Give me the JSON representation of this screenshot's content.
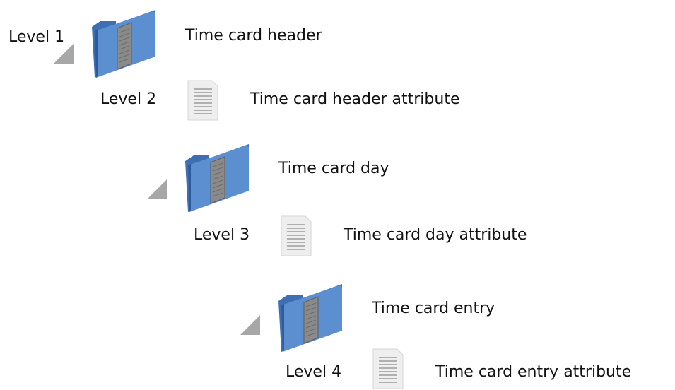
{
  "levels": {
    "level1": "Level 1",
    "level2": "Level 2",
    "level3": "Level 3",
    "level4": "Level 4"
  },
  "items": {
    "time_card_header": "Time card header",
    "time_card_header_attribute": "Time card header attribute",
    "time_card_day": "Time card day",
    "time_card_day_attribute": "Time card day attribute",
    "time_card_entry": "Time card entry",
    "time_card_entry_attribute": "Time card entry attribute"
  },
  "colors": {
    "folder_front": "#5b8fd0",
    "folder_back": "#3f6fb3",
    "folder_page": "#8a8a8a",
    "triangle": "#a7a7a7",
    "document_fill": "#eeeeee",
    "document_lines": "#9c9c9c"
  },
  "icons": {
    "folder": "folder-icon",
    "document": "document-icon",
    "expand": "expand-triangle-icon"
  }
}
